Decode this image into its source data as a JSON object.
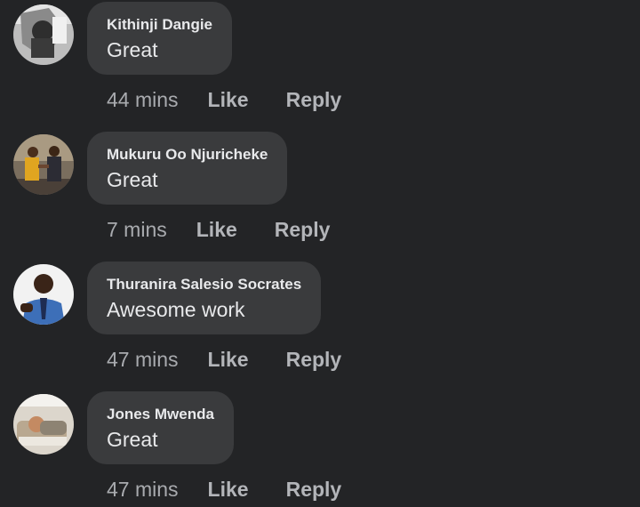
{
  "comments": [
    {
      "author": "Kithinji Dangie",
      "text": "Great",
      "time": "44 mins",
      "like_label": "Like",
      "reply_label": "Reply",
      "avatar_icon": "grayscale-photo-avatar"
    },
    {
      "author": "Mukuru Oo Njuricheke",
      "text": "Great",
      "time": "7 mins",
      "like_label": "Like",
      "reply_label": "Reply",
      "avatar_icon": "handshake-photo-avatar"
    },
    {
      "author": "Thuranira Salesio Socrates",
      "text": "Awesome work",
      "time": "47 mins",
      "like_label": "Like",
      "reply_label": "Reply",
      "avatar_icon": "portrait-photo-avatar"
    },
    {
      "author": "Jones Mwenda",
      "text": "Great",
      "time": "47 mins",
      "like_label": "Like",
      "reply_label": "Reply",
      "avatar_icon": "sleeping-person-photo-avatar"
    }
  ],
  "colors": {
    "background": "#232426",
    "bubble": "#3a3b3d",
    "text": "#e8e9eb",
    "meta": "#a9abaf"
  }
}
